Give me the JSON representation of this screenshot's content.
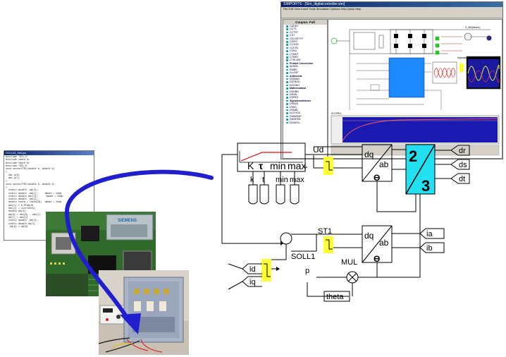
{
  "simulator": {
    "window_title": "SIMPORTS - [Sim_digitalcontroller.sim]",
    "menu": "File  Edit  View  Insert  Tools  Simulation  Options  Help  Quick Help",
    "library_title": "Coupon: Full",
    "library_items": [
      "CATAN",
      "CCT3",
      "CCTST",
      "CDT",
      "CELDETYP",
      "CERO",
      "CLOGD",
      "CLTON",
      "CON4",
      "CTMST",
      "CTMST",
      "CTRL4B1",
      "ADMIN",
      "RMBS",
      "DLOOP",
      "DIOBAN",
      "DZTBOD",
      "DOSINO",
      "DSHBN",
      "DRAN",
      "DSREX",
      "DSN4S",
      "DSM1",
      "DSMBL",
      "DLCHOD",
      "DWMSMP",
      "DWSEEB",
      "DZ4ASA"
    ],
    "library_folders": [
      "Printed Conversion",
      "Arithmetic",
      "Mathematical",
      "Signalconditioner"
    ],
    "block_label_top": "S_MD(Motor)",
    "block_label_mid": "Adjustable Speed",
    "scope_label": "SCOPE1"
  },
  "code_editor": {
    "title": "DS1103_Setupo",
    "lines": [
      "#include \"DS1.h\"",
      "#include <math.h>",
      "#include <math.h>",
      "#include \"DS1.h\"",
      "void vectorCTRL(double a, double b)",
      "{",
      "  abc_w[0]",
      "  abc_w[1]",
      "}",
      "void vectorCTRL(double a, double b)",
      "{",
      "  static double _ab[3];",
      "  static double _ab[1];     dbmat = &tmp",
      "  static double abc[3];      dbmat = &tmp",
      "  static double _ab[2];",
      "  double theta = theta[0];  dbmat = &tmp",
      "  abc[1] = 0.5*ab[0]",
      "  abc[2] = sin(theta)",
      "  double ab[4];",
      "  ab[0] = abc[0] - abc[1]",
      "  ab[1] = abc[2]",
      "  static double _ab[2];",
      "  static double ab[3]",
      "  _ab[0] = ab[0]"
    ]
  },
  "photo_labels": {
    "board_brand": "SIEMENS"
  },
  "diagram": {
    "pi_labels": [
      "K",
      "τ",
      "min",
      "max"
    ],
    "pi_input_ports": [
      "k",
      "t",
      "min",
      "max"
    ],
    "ud_label": "Ud",
    "dq_ab_top": {
      "dq": "dq",
      "ab": "ab",
      "theta": "ϴ"
    },
    "dq_ab_bottom": {
      "dq": "dq",
      "ab": "ab",
      "theta": "ϴ"
    },
    "converter_23": {
      "top": "2",
      "bottom": "3",
      "color": "#22e0f0"
    },
    "outputs": [
      "dr",
      "ds",
      "dt"
    ],
    "inputs_right": [
      "ia",
      "ib"
    ],
    "inputs_left": [
      "id",
      "iq"
    ],
    "st1_label": "ST1",
    "soll1_label": "SOLL1",
    "mul_label": "MUL",
    "p_label": "p",
    "theta_label": "theta",
    "highlight_color": "#ffff33"
  }
}
